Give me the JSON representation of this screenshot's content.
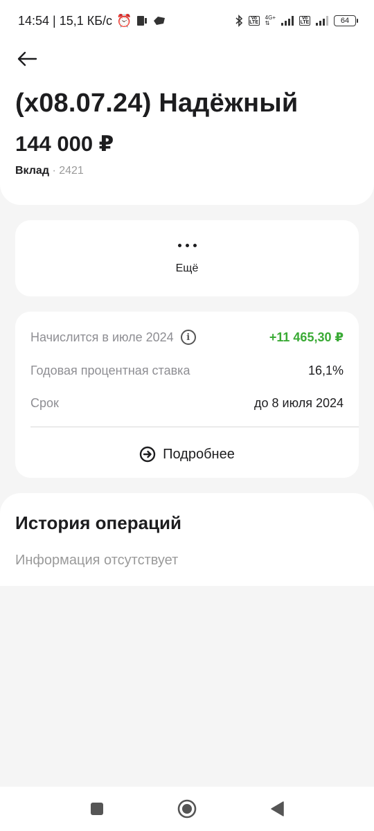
{
  "status_bar": {
    "time_info": "14:54 | 15,1 КБ/с",
    "network_label": "4G+",
    "volte_label_top": "Vo",
    "volte_label_bottom": "LTE",
    "battery_level": "64"
  },
  "header": {
    "title": "(x08.07.24) Надёжный",
    "amount": "144 000 ₽",
    "product_type": "Вклад",
    "separator": "·",
    "account_suffix": "2421"
  },
  "more": {
    "label": "Ещё"
  },
  "info": {
    "rows": [
      {
        "label": "Начислится в июле 2024",
        "value": "+11 465,30 ₽"
      },
      {
        "label": "Годовая процентная ставка",
        "value": "16,1%"
      },
      {
        "label": "Срок",
        "value": "до 8 июля 2024"
      }
    ],
    "details_label": "Подробнее"
  },
  "history": {
    "title": "История операций",
    "empty_text": "Информация отсутствует"
  },
  "colors": {
    "accent_green": "#3aaa35",
    "text_primary": "#1d1d1f",
    "text_secondary": "#8e8e93",
    "background": "#f5f5f5"
  },
  "icons": {
    "back": "arrow-left-icon",
    "more": "ellipsis-icon",
    "info": "info-icon",
    "details": "arrow-right-circle-icon",
    "nav_recent": "square-icon",
    "nav_home": "circle-icon",
    "nav_back": "triangle-back-icon"
  }
}
